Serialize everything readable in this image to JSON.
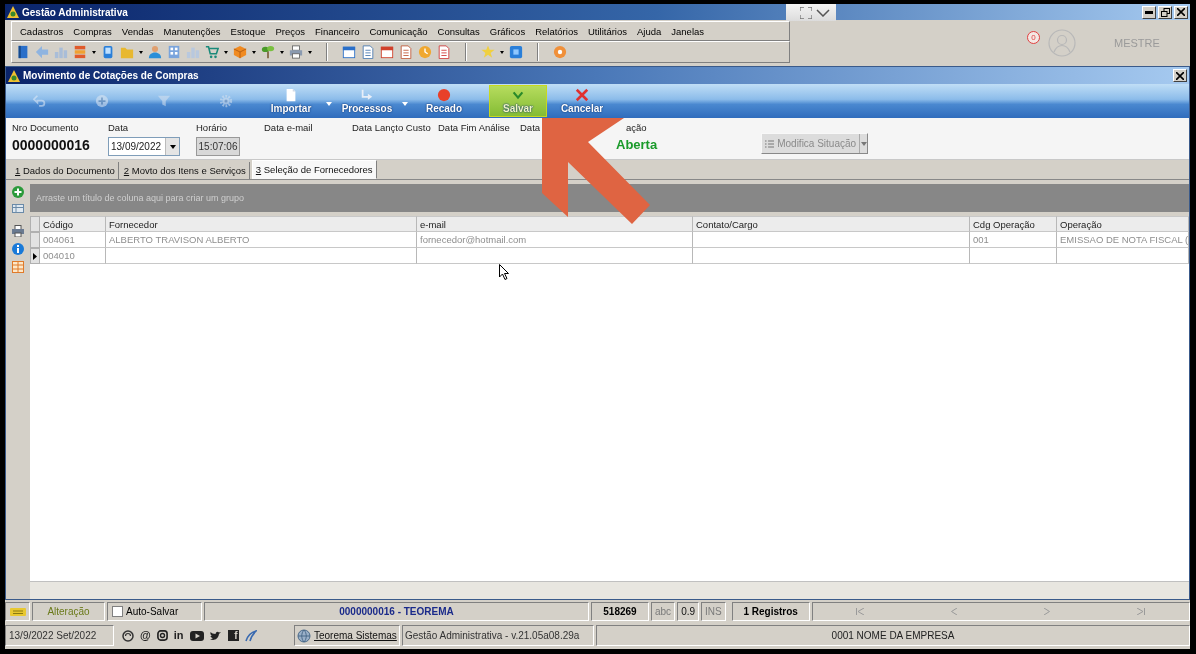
{
  "app_window": {
    "title": "Gestão Administrativa"
  },
  "menu": [
    "Cadastros",
    "Compras",
    "Vendas",
    "Manutenções",
    "Estoque",
    "Preços",
    "Financeiro",
    "Comunicação",
    "Consultas",
    "Gráficos",
    "Relatórios",
    "Utilitários",
    "Ajuda",
    "Janelas"
  ],
  "notifications": {
    "count": "0"
  },
  "user": {
    "name": "MESTRE"
  },
  "document_window": {
    "title": "Movimento de Cotações de Compras",
    "toolbar": [
      {
        "disabled": true,
        "dropdown": false,
        "highlighted": false
      },
      {
        "disabled": true,
        "dropdown": false,
        "highlighted": false
      },
      {
        "disabled": true,
        "dropdown": false,
        "highlighted": false
      },
      {
        "disabled": true,
        "dropdown": false,
        "highlighted": false
      },
      {
        "label": "Importar",
        "disabled": false,
        "dropdown": true,
        "highlighted": false
      },
      {
        "label": "Processos",
        "disabled": false,
        "dropdown": true,
        "highlighted": false
      },
      {
        "label": "Recado",
        "disabled": false,
        "dropdown": false,
        "highlighted": false
      },
      {
        "label": "Salvar",
        "disabled": false,
        "dropdown": false,
        "highlighted": true
      },
      {
        "label": "Cancelar",
        "disabled": false,
        "dropdown": false,
        "highlighted": false
      }
    ],
    "header_fields": [
      {
        "kind": "number",
        "label": "Nro Documento",
        "value": "0000000016"
      },
      {
        "kind": "date",
        "label": "Data",
        "value": "13/09/2022"
      },
      {
        "kind": "time",
        "label": "Horário",
        "value": "15:07:06"
      },
      {
        "kind": "label",
        "label": "Data e-mail"
      },
      {
        "kind": "label",
        "label": "Data Lançto Custo"
      },
      {
        "kind": "label",
        "label": "Data Fim Análise"
      },
      {
        "kind": "label",
        "label": "Data"
      },
      {
        "kind": "status",
        "label": "ação",
        "value": "Aberta"
      }
    ],
    "situation_button": {
      "label": "Modifica Situação",
      "disabled": true
    },
    "tabs": [
      {
        "key": "1",
        "label": "Dados do Documento",
        "selected": false
      },
      {
        "key": "2",
        "label": "Movto dos Itens e Serviços",
        "selected": false
      },
      {
        "key": "3",
        "label": "Seleção de Fornecedores",
        "selected": true
      }
    ],
    "grid": {
      "group_hint": "Arraste um título de coluna aqui para criar um grupo",
      "columns": [
        "Código",
        "Fornecedor",
        "e-mail",
        "Contato/Cargo",
        "Cdg Operação",
        "Operação"
      ],
      "rows": [
        {
          "current": false,
          "cells": [
            "004061",
            "ALBERTO TRAVISON ALBERTO",
            "fornecedor@hotmail.com",
            null,
            "001",
            "EMISSAO DE NOTA FISCAL ("
          ]
        },
        {
          "current": true,
          "cells": [
            "004010",
            null,
            null,
            null,
            null,
            null
          ]
        }
      ]
    }
  },
  "status_bar": {
    "mode": "Alteração",
    "auto_save": {
      "label": "Auto-Salvar",
      "checked": false
    },
    "document": "0000000016 - TEOREMA",
    "code": "518269",
    "indicators": [
      {
        "label": "abc",
        "active": false
      },
      {
        "label": "0.9",
        "active": true
      },
      {
        "label": "INS",
        "active": false
      }
    ],
    "records": "1 Registros"
  },
  "footer": {
    "date": "13/9/2022 Set/2022",
    "social_icons": [
      {
        "kind": "ring"
      },
      {
        "kind": "glyph",
        "text": "@"
      },
      {
        "kind": "camera"
      },
      {
        "kind": "glyph",
        "text": "in"
      },
      {
        "kind": "play"
      },
      {
        "kind": "bird"
      },
      {
        "kind": "tile",
        "text": "f"
      },
      {
        "kind": "swoosh"
      }
    ],
    "link": "Teorema Sistemas",
    "version": "Gestão Administrativa - v.21.05a08.29a",
    "company": "0001 NOME DA EMPRESA"
  }
}
